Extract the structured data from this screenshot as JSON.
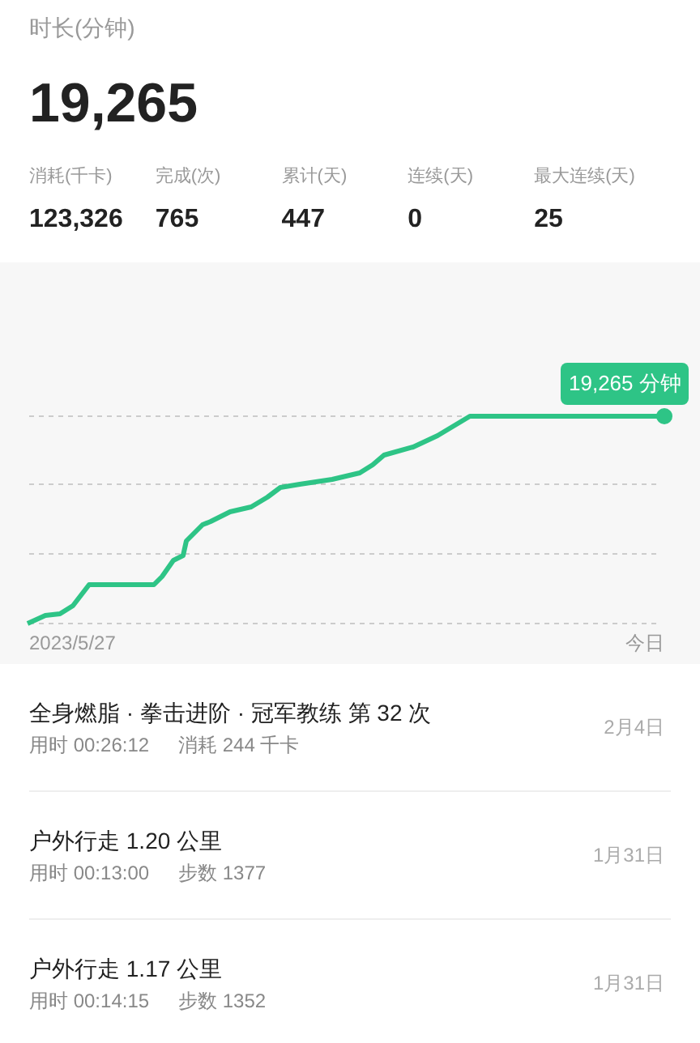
{
  "summary": {
    "label": "时长(分钟)",
    "value": "19,265"
  },
  "stats": [
    {
      "label": "消耗(千卡)",
      "value": "123,326"
    },
    {
      "label": "完成(次)",
      "value": "765"
    },
    {
      "label": "累计(天)",
      "value": "447"
    },
    {
      "label": "连续(天)",
      "value": "0"
    },
    {
      "label": "最大连续(天)",
      "value": "25"
    }
  ],
  "chart": {
    "tooltip": "19,265 分钟",
    "x_start": "2023/5/27",
    "x_end": "今日"
  },
  "records": [
    {
      "title": "全身燃脂 · 拳击进阶 · 冠军教练 第 32 次",
      "duration": "用时 00:26:12",
      "detail": "消耗 244 千卡",
      "date": "2月4日"
    },
    {
      "title": "户外行走 1.20 公里",
      "duration": "用时 00:13:00",
      "detail": "步数 1377",
      "date": "1月31日"
    },
    {
      "title": "户外行走 1.17 公里",
      "duration": "用时 00:14:15",
      "detail": "步数 1352",
      "date": "1月31日"
    }
  ]
}
